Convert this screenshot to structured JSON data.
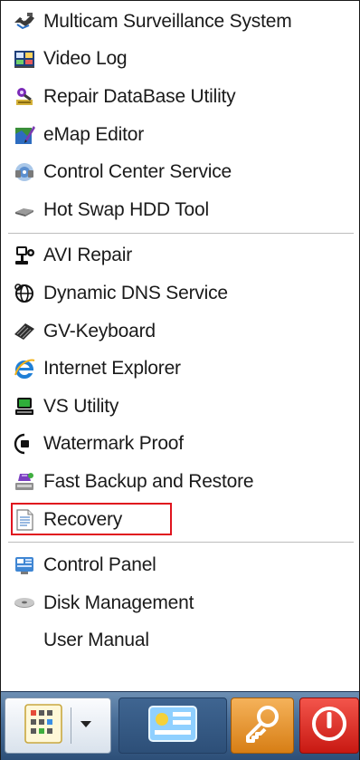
{
  "menu": {
    "groups": [
      {
        "items": [
          {
            "label": "Multicam Surveillance System",
            "icon": "multicam-icon"
          },
          {
            "label": "Video Log",
            "icon": "video-log-icon"
          },
          {
            "label": "Repair DataBase Utility",
            "icon": "repair-database-icon"
          },
          {
            "label": "eMap Editor",
            "icon": "emap-icon"
          },
          {
            "label": "Control Center Service",
            "icon": "control-center-icon"
          },
          {
            "label": "Hot Swap HDD Tool",
            "icon": "hdd-tool-icon"
          }
        ]
      },
      {
        "items": [
          {
            "label": "AVI Repair",
            "icon": "avi-repair-icon"
          },
          {
            "label": "Dynamic DNS Service",
            "icon": "dns-icon"
          },
          {
            "label": "GV-Keyboard",
            "icon": "keyboard-icon"
          },
          {
            "label": "Internet Explorer",
            "icon": "internet-explorer-icon"
          },
          {
            "label": "VS Utility",
            "icon": "vs-utility-icon"
          },
          {
            "label": "Watermark Proof",
            "icon": "watermark-icon"
          },
          {
            "label": "Fast Backup and Restore",
            "icon": "backup-icon"
          },
          {
            "label": "Recovery",
            "icon": "recovery-icon",
            "highlighted": true
          }
        ]
      },
      {
        "items": [
          {
            "label": "Control Panel",
            "icon": "control-panel-icon"
          },
          {
            "label": "Disk Management",
            "icon": "disk-icon"
          },
          {
            "label": "User Manual",
            "icon": ""
          }
        ]
      }
    ]
  },
  "taskbar": {
    "buttons": [
      {
        "name": "start-menu-button",
        "icon": "grid-menu-icon"
      },
      {
        "name": "control-panel-taskbar-button",
        "icon": "control-panel-icon"
      },
      {
        "name": "key-button",
        "icon": "key-icon"
      },
      {
        "name": "power-button",
        "icon": "power-icon"
      }
    ]
  },
  "colors": {
    "highlight_border": "#e0141e",
    "separator": "#bdbdbd",
    "taskbar": "#3b5e88",
    "key_button": "#e89432",
    "power_button": "#de2a21"
  }
}
